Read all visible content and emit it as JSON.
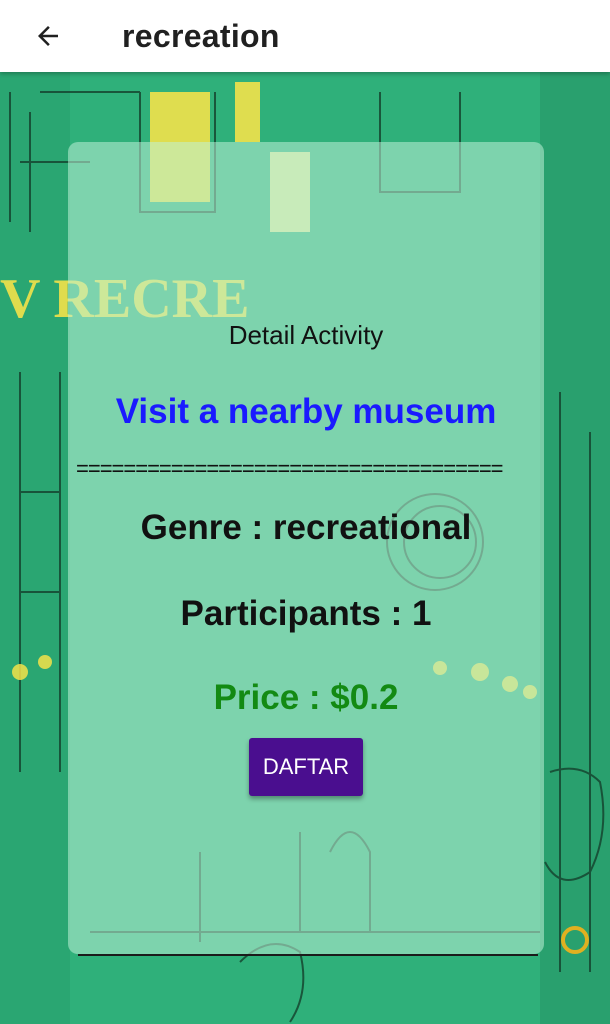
{
  "appbar": {
    "title": "recreation",
    "back_icon": "arrow-left-icon"
  },
  "detail": {
    "heading": "Detail Activity",
    "activity": "Visit a nearby museum",
    "divider": "====================================",
    "genre": "Genre : recreational",
    "participants": "Participants : 1",
    "price": "Price : $0.2",
    "button_label": "DAFTAR"
  },
  "colors": {
    "activity_text": "#1a1aff",
    "price_text": "#138a13",
    "button_bg": "#4a0e8f",
    "background": "#2fb07a"
  }
}
